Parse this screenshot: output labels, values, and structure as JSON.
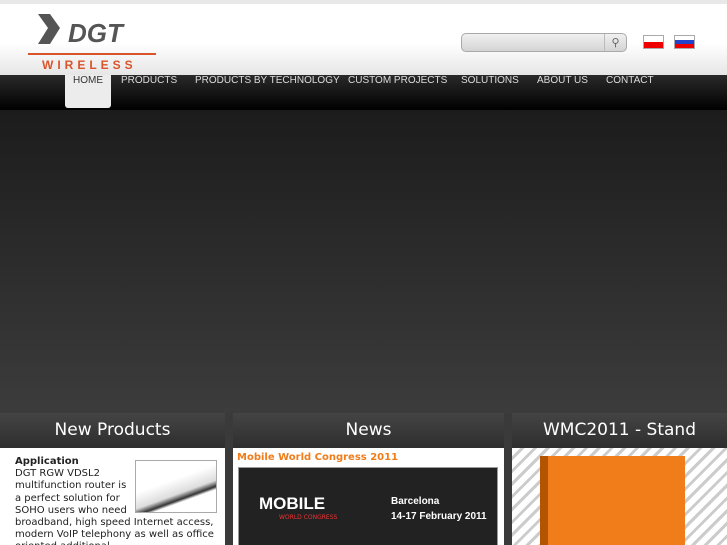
{
  "logo": {
    "brand": "DGT",
    "sub": "WIRELESS"
  },
  "search": {
    "placeholder": "",
    "button_icon": "search-icon"
  },
  "languages": [
    "Polish",
    "Russian"
  ],
  "nav": [
    "HOME",
    "PRODUCTS",
    "PRODUCTS BY TECHNOLOGY",
    "CUSTOM PROJECTS",
    "SOLUTIONS",
    "ABOUT US",
    "CONTACT"
  ],
  "new_products": {
    "title": "New Products",
    "heading": "Application",
    "text": "DGT RGW VDSL2 multifunction router is a perfect solution for SOHO users who need broadband, high speed Internet access, modern VoIP telephony as well as office oriented additional"
  },
  "news": {
    "title": "News",
    "item_title": "Mobile World Congress 2011",
    "banner": {
      "brand": "MOBILE",
      "sub": "WORLD CONGRESS",
      "city": "Barcelona",
      "dates": "14-17 February 2011"
    }
  },
  "stand": {
    "title": "WMC2011 - Stand"
  }
}
